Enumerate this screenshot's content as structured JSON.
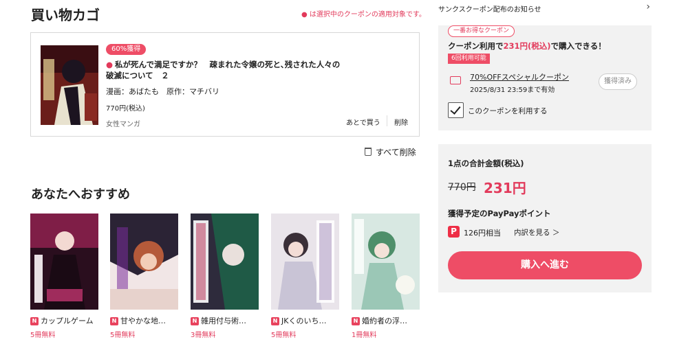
{
  "cart": {
    "title": "買い物カゴ",
    "note": "● は選択中のクーポンの適用対象です。",
    "item": {
      "badge": "60%獲得",
      "title": "私が死んで満足ですか？　疎まれた令嬢の死と､残された人々の破滅について　２",
      "author": "漫画：あばたも　原作：マチバリ",
      "price": "770円(税込)",
      "genre": "女性マンガ",
      "save_later": "あとで買う",
      "delete": "削除"
    },
    "delete_all": "すべて削除"
  },
  "recommend": {
    "title": "あなたへおすすめ",
    "badge_letter": "N",
    "items": [
      {
        "name": "カップルゲーム",
        "free": "5冊無料"
      },
      {
        "name": "甘やかな地…",
        "free": "5冊無料"
      },
      {
        "name": "雑用付与術…",
        "free": "3冊無料"
      },
      {
        "name": "JKくのいち…",
        "free": "5冊無料"
      },
      {
        "name": "婚約者の浮…",
        "free": "1冊無料"
      }
    ]
  },
  "sidebar": {
    "notice": "サンクスクーポン配布のお知らせ",
    "coupon": {
      "best_badge": "一番お得なクーポン",
      "headline_prefix": "クーポン利用で",
      "headline_price": "231円(税込)",
      "headline_suffix": "で購入できる！",
      "usable": "6回利用可能",
      "name": "70%OFFスペシャルクーポン",
      "expiry": "2025/8/31 23:59まで有効",
      "acquired": "獲得済み",
      "use_label": "このクーポンを利用する",
      "use_checked": true
    },
    "total": {
      "label": "1点の合計金額(税込)",
      "original": "770円",
      "sale": "231円",
      "points_label": "獲得予定のPayPayポイント",
      "points_value": "126円相当",
      "points_detail": "内訳を見る ＞",
      "buy": "購入へ進む"
    }
  },
  "colors": {
    "accent": "#ee4d66",
    "accent_text": "#e23a5b",
    "panel_bg": "#f2f2f2"
  }
}
